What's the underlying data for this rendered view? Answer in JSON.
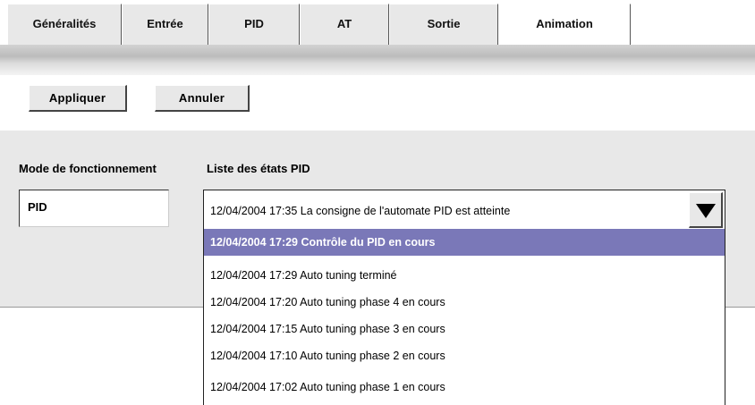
{
  "tabs": [
    {
      "label": "Généralités"
    },
    {
      "label": "Entrée"
    },
    {
      "label": "PID"
    },
    {
      "label": "AT"
    },
    {
      "label": "Sortie"
    },
    {
      "label": "Animation"
    }
  ],
  "toolbar": {
    "apply_label": "Appliquer",
    "cancel_label": "Annuler"
  },
  "mode": {
    "label": "Mode de fonctionnement",
    "value": "PID"
  },
  "states": {
    "label": "Liste des états PID",
    "selected": "12/04/2004  17:35  La consigne de l'automate PID est atteinte",
    "options": [
      "12/04/2004  17:29  Contrôle du PID en cours",
      "12/04/2004  17:29  Auto tuning terminé",
      "12/04/2004  17:20  Auto tuning phase 4 en cours",
      "12/04/2004  17:15  Auto tuning phase 3 en cours",
      "12/04/2004  17:10  Auto tuning phase 2 en cours",
      "12/04/2004  17:02  Auto tuning phase 1 en cours"
    ]
  },
  "colors": {
    "highlight": "#7a78b8",
    "panel": "#e8e8e8"
  },
  "icons": {
    "dropdown": "triangle-down-icon"
  }
}
